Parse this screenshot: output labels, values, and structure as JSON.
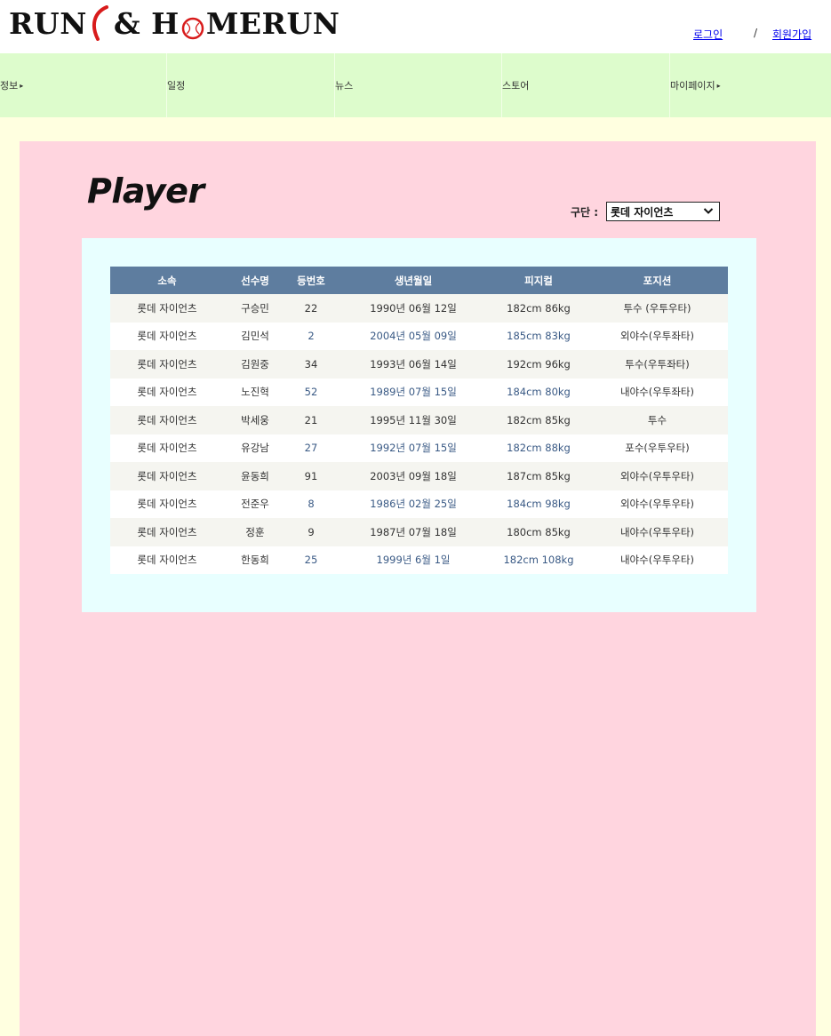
{
  "header": {
    "logo_left": "RUN",
    "logo_amp": "& H",
    "logo_right": "MERUN",
    "login": "로그인",
    "separator": "/",
    "signup": "회원가입"
  },
  "nav": {
    "items": [
      {
        "label": "정보",
        "caret": "▸"
      },
      {
        "label": "일정"
      },
      {
        "label": "뉴스"
      },
      {
        "label": "스토어"
      },
      {
        "label": "마이페이지",
        "caret": "▸"
      }
    ]
  },
  "page": {
    "title": "Player",
    "team_label": "구단 :",
    "team_selected": "롯데 자이언츠"
  },
  "table": {
    "headers": [
      "소속",
      "선수명",
      "등번호",
      "생년월일",
      "피지컬",
      "포지션"
    ],
    "rows": [
      [
        "롯데 자이언츠",
        "구승민",
        "22",
        "1990년 06월 12일",
        "182cm 86kg",
        "투수 (우투우타)"
      ],
      [
        "롯데 자이언츠",
        "김민석",
        "2",
        "2004년 05월 09일",
        "185cm 83kg",
        "외야수(우투좌타)"
      ],
      [
        "롯데 자이언츠",
        "김원중",
        "34",
        "1993년 06월 14일",
        "192cm 96kg",
        "투수(우투좌타)"
      ],
      [
        "롯데 자이언츠",
        "노진혁",
        "52",
        "1989년 07월 15일",
        "184cm 80kg",
        "내야수(우투좌타)"
      ],
      [
        "롯데 자이언츠",
        "박세웅",
        "21",
        "1995년 11월 30일",
        "182cm 85kg",
        "투수"
      ],
      [
        "롯데 자이언츠",
        "유강남",
        "27",
        "1992년 07월 15일",
        "182cm 88kg",
        "포수(우투우타)"
      ],
      [
        "롯데 자이언츠",
        "윤동희",
        "91",
        "2003년 09월 18일",
        "187cm 85kg",
        "외야수(우투우타)"
      ],
      [
        "롯데 자이언츠",
        "전준우",
        "8",
        "1986년 02월 25일",
        "184cm 98kg",
        "외야수(우투우타)"
      ],
      [
        "롯데 자이언츠",
        "정훈",
        "9",
        "1987년 07월 18일",
        "180cm 85kg",
        "내야수(우투우타)"
      ],
      [
        "롯데 자이언츠",
        "한동희",
        "25",
        "1999년 6월 1일",
        "182cm 108kg",
        "내야수(우투우타)"
      ]
    ]
  },
  "colors": {
    "page_bg": "#ffffe0",
    "nav_bg": "#ddfccc",
    "panel_bg": "#ffd5df",
    "table_box_bg": "#e8ffff",
    "table_header_bg": "#5e7d9f",
    "logo_swoosh": "#d81b1b"
  }
}
